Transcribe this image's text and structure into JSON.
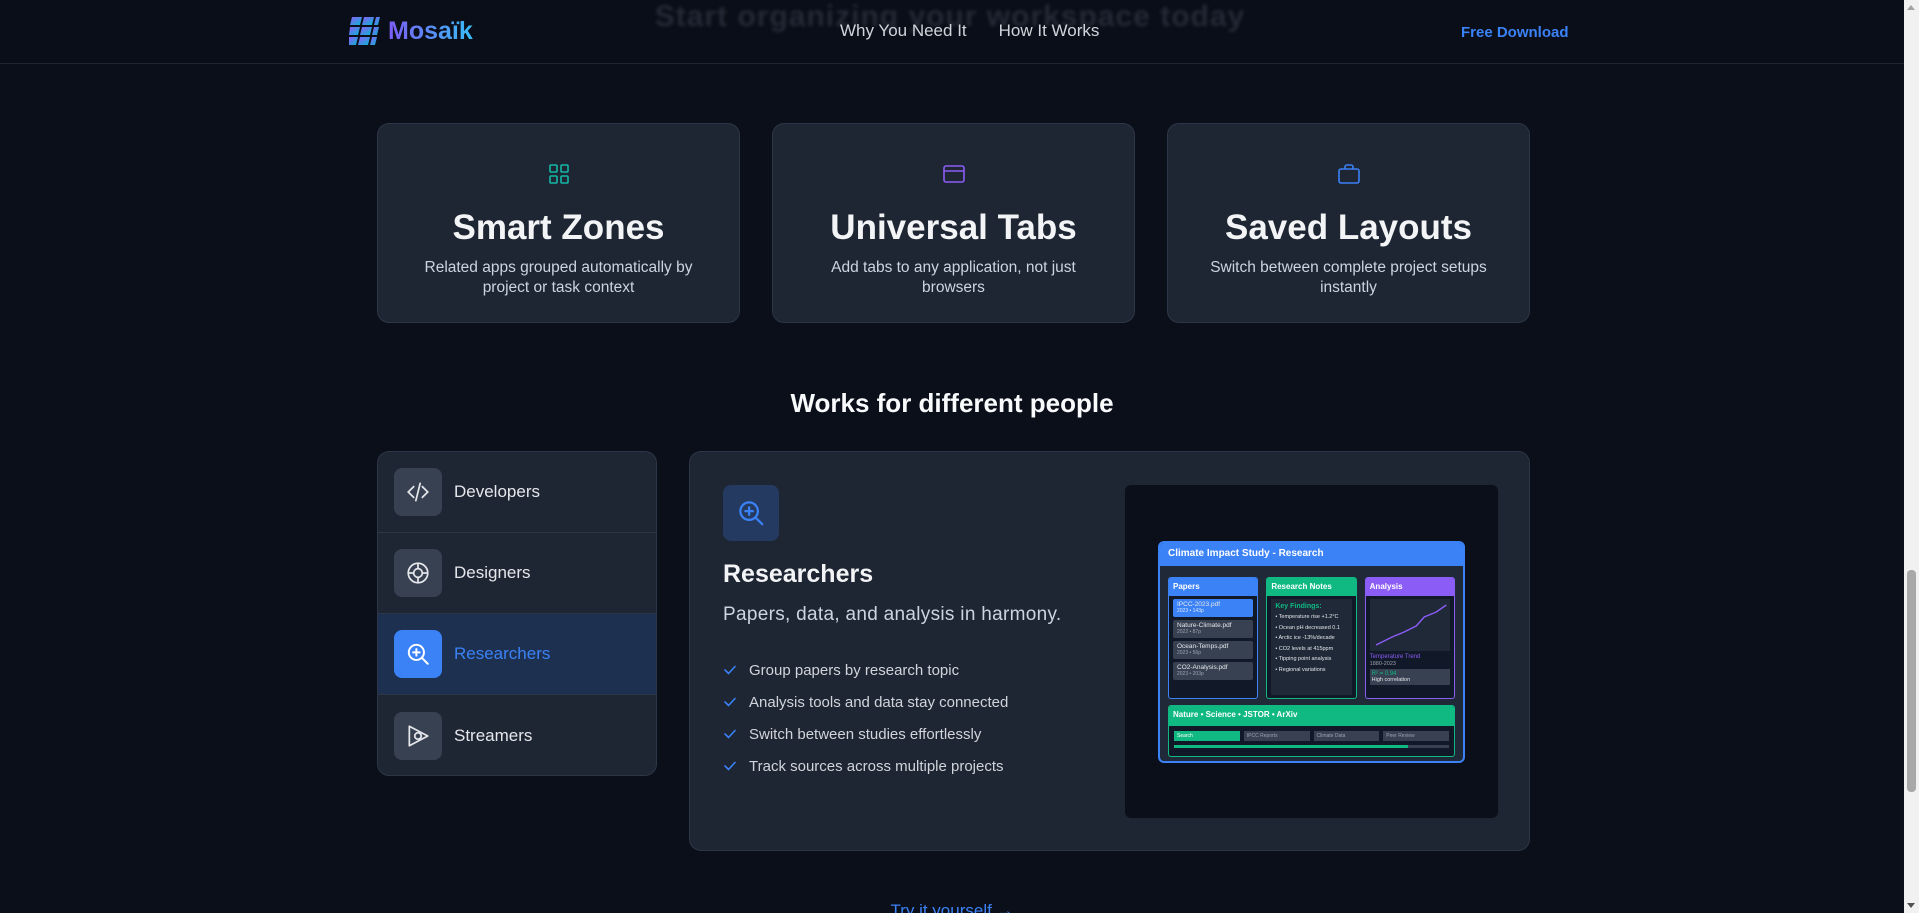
{
  "nav": {
    "brand": "Mosaïk",
    "links": [
      "Why You Need It",
      "How It Works"
    ],
    "cta": "Free Download"
  },
  "features": [
    {
      "icon": "grid-icon",
      "icon_color": "#14b8a6",
      "title": "Smart Zones",
      "desc": "Related apps grouped automatically by project or task context"
    },
    {
      "icon": "window-icon",
      "icon_color": "#8b5cf6",
      "title": "Universal Tabs",
      "desc": "Add tabs to any application, not just browsers"
    },
    {
      "icon": "briefcase-icon",
      "icon_color": "#3b82f6",
      "title": "Saved Layouts",
      "desc": "Switch between complete project setups instantly"
    }
  ],
  "section_title": "Works for different people",
  "personas": [
    {
      "label": "Developers",
      "icon": "code-icon"
    },
    {
      "label": "Designers",
      "icon": "target-icon"
    },
    {
      "label": "Researchers",
      "icon": "magnify-plus-icon",
      "active": true
    },
    {
      "label": "Streamers",
      "icon": "play-icon"
    }
  ],
  "detail": {
    "title": "Researchers",
    "subtitle": "Papers, data, and analysis in harmony.",
    "bullets": [
      "Group papers by research topic",
      "Analysis tools and data stay connected",
      "Switch between studies effortlessly",
      "Track sources across multiple projects"
    ]
  },
  "preview": {
    "window_title": "Climate Impact Study - Research",
    "papers": {
      "header": "Papers",
      "items": [
        {
          "name": "IPCC-2023.pdf",
          "meta": "2023 • 143p"
        },
        {
          "name": "Nature-Climate.pdf",
          "meta": "2022 • 87p"
        },
        {
          "name": "Ocean-Temps.pdf",
          "meta": "2023 • 56p"
        },
        {
          "name": "CO2-Analysis.pdf",
          "meta": "2023 • 203p"
        }
      ]
    },
    "notes": {
      "header": "Research Notes",
      "key": "Key Findings:",
      "items": [
        "• Temperature rise +1.2°C",
        "• Ocean pH decreased 0.1",
        "• Arctic ice -13%/decade",
        "• CO2 levels at 415ppm",
        "• Tipping point analysis",
        "• Regional variations"
      ]
    },
    "analysis": {
      "header": "Analysis",
      "chart_label": "Temperature Trend",
      "range": "1880-2023",
      "stat": "R² = 0.94",
      "stat_note": "High correlation"
    },
    "sources": {
      "header": "Nature • Science • JSTOR • ArXiv",
      "tabs": [
        "Search",
        "IPCC Reports",
        "Climate Data",
        "Peer Review"
      ]
    }
  },
  "try_link": "Try it yourself →",
  "ghost_heading": "Start organizing your workspace today"
}
